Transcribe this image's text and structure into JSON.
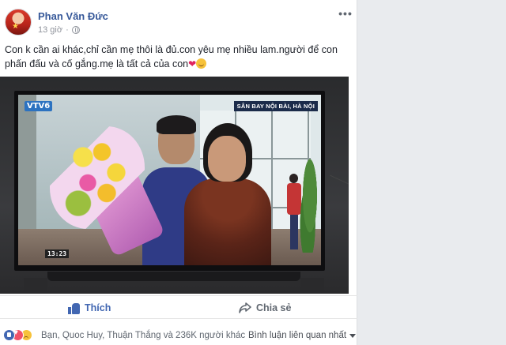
{
  "post": {
    "author": "Phan Văn Đức",
    "time": "13 giờ",
    "more_label": "•••",
    "text_main": "Con k cần ai khác,chỉ cần mẹ thôi là đủ.con yêu mẹ nhiều lam.người để con phấn đấu và cố gắng.mẹ là tất cả của con",
    "text_heart": "❤"
  },
  "photo": {
    "channel_logo": "VTV6",
    "location_caption": "SÂN BAY NỘI BÀI, HÀ NỘI",
    "timecode": "13:23"
  },
  "actions": {
    "like_label": "Thích",
    "share_label": "Chia sẻ"
  },
  "footer": {
    "reactions_summary": "Bạn, Quoc Huy, Thuận Thắng và 236K người khác",
    "sort_label": "Bình luận liên quan nhất"
  },
  "colors": {
    "link_blue": "#365899",
    "like_blue": "#4267b2",
    "meta_gray": "#90949c",
    "page_bg": "#e9ebee"
  },
  "icons": [
    "globe-icon",
    "more-options-icon",
    "heart-emoji",
    "smile-emoji",
    "like-icon",
    "share-icon",
    "like-reaction-icon",
    "love-reaction-icon",
    "sad-reaction-icon",
    "chevron-down-icon"
  ]
}
